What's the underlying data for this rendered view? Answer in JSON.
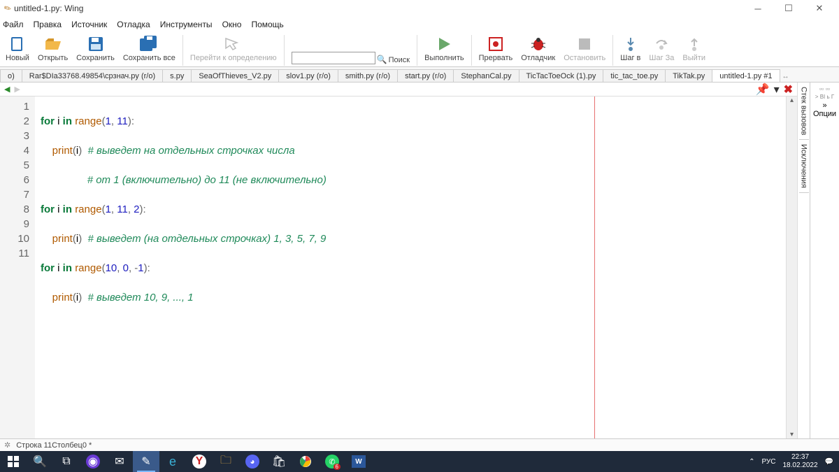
{
  "window": {
    "title": "untitled-1.py: Wing"
  },
  "menu": [
    "Файл",
    "Правка",
    "Источник",
    "Отладка",
    "Инструменты",
    "Окно",
    "Помощь"
  ],
  "toolbar": {
    "new": "Новый",
    "open": "Открыть",
    "save": "Сохранить",
    "save_all": "Сохранить все",
    "goto": "Перейти к определению",
    "search": "Поиск",
    "run": "Выполнить",
    "stop": "Прервать",
    "debug": "Отладчик",
    "terminate": "Остановить",
    "step_in": "Шаг в",
    "step_over": "Шаг За",
    "step_out": "Выйти"
  },
  "tabs": [
    {
      "label": "o)",
      "active": false
    },
    {
      "label": "Rar$DIa33768.49854\\срзнач.py (r/o)",
      "active": false
    },
    {
      "label": "s.py",
      "active": false
    },
    {
      "label": "SeaOfThieves_V2.py",
      "active": false
    },
    {
      "label": "slov1.py (r/o)",
      "active": false
    },
    {
      "label": "smith.py (r/o)",
      "active": false
    },
    {
      "label": "start.py (r/o)",
      "active": false
    },
    {
      "label": "StephanCal.py",
      "active": false
    },
    {
      "label": "TicTacToeOck (1).py",
      "active": false
    },
    {
      "label": "tic_tac_toe.py",
      "active": false
    },
    {
      "label": "TikTak.py",
      "active": false
    },
    {
      "label": "untitled-1.py #1",
      "active": true
    }
  ],
  "code": {
    "lines": [
      1,
      2,
      3,
      4,
      5,
      6,
      7,
      8,
      9,
      10,
      11
    ],
    "l1": {
      "k1": "for",
      "id": " i ",
      "k2": "in",
      "sp": " ",
      "fn": "range",
      "op1": "(",
      "n1": "1",
      "cm": ",",
      "sp2": " ",
      "n2": "11",
      "op2": "):"
    },
    "l2": {
      "ind": "    ",
      "fn": "print",
      "op1": "(",
      "id": "i",
      "op2": ")",
      "sp": "  ",
      "c": "# выведет на отдельных строчках числа"
    },
    "l3": {
      "ind": "                ",
      "c": "# от 1 (включительно) до 11 (не включительно)"
    },
    "l4": {
      "k1": "for",
      "id": " i ",
      "k2": "in",
      "sp": " ",
      "fn": "range",
      "op1": "(",
      "n1": "1",
      "cm1": ",",
      "sp1": " ",
      "n2": "11",
      "cm2": ",",
      "sp2": " ",
      "n3": "2",
      "op2": "):"
    },
    "l5": {
      "ind": "    ",
      "fn": "print",
      "op1": "(",
      "id": "i",
      "op2": ")",
      "sp": "  ",
      "c": "# выведет (на отдельных строчках) 1, 3, 5, 7, 9"
    },
    "l6": {
      "k1": "for",
      "id": " i ",
      "k2": "in",
      "sp": " ",
      "fn": "range",
      "op1": "(",
      "n1": "10",
      "cm1": ",",
      "sp1": " ",
      "n2": "0",
      "cm2": ",",
      "sp2": " ",
      "neg": "-",
      "n3": "1",
      "op2": "):"
    },
    "l7": {
      "ind": "    ",
      "fn": "print",
      "op1": "(",
      "id": "i",
      "op2": ")",
      "sp": "  ",
      "c": "# выведет 10, 9, ..., 1"
    }
  },
  "side": {
    "tab1": "Стек вызовов",
    "tab2": "Исключения",
    "options": "Опции",
    "tiny": "> BI ь Г"
  },
  "status": {
    "pos": "Строка 11Столбец0 *"
  },
  "taskbar": {
    "lang": "РУС",
    "time": "22:37",
    "date": "18.02.2022"
  }
}
